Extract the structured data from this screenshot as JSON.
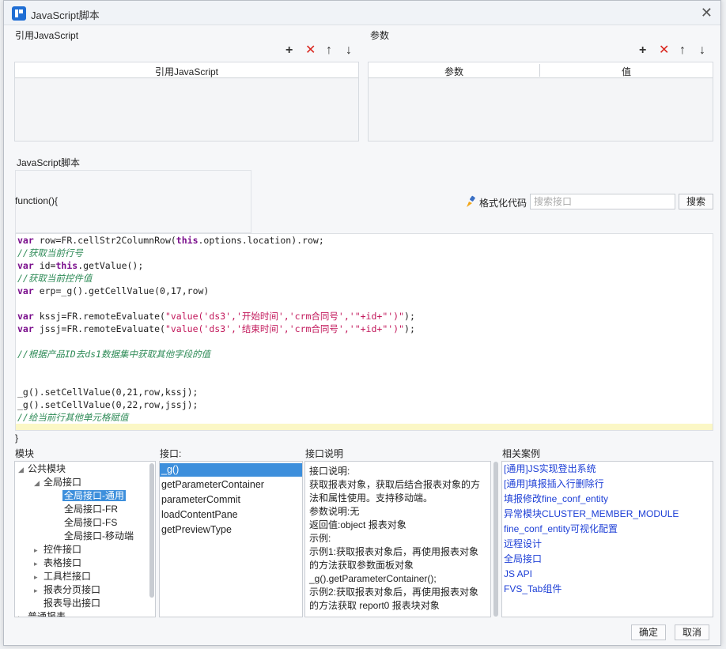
{
  "window": {
    "title": "JavaScript脚本"
  },
  "ref_section": {
    "label": "引用JavaScript",
    "column": "引用JavaScript"
  },
  "param_section": {
    "label": "参数",
    "columns": [
      "参数",
      "值"
    ]
  },
  "script_section": {
    "label": "JavaScript脚本",
    "function_header": "function(){",
    "format_label": "格式化代码",
    "search_placeholder": "搜索接口",
    "search_button": "搜索",
    "closing": "}"
  },
  "code_lines": [
    "var row=FR.cellStr2ColumnRow(this.options.location).row;",
    "//获取当前行号",
    "var id=this.getValue();",
    "//获取当前控件值",
    "var erp=_g().getCellValue(0,17,row)",
    "",
    "var kssj=FR.remoteEvaluate(\"value('ds3','开始时间','crm合同号','\"+id+\"')\");",
    "var jssj=FR.remoteEvaluate(\"value('ds3','结束时间','crm合同号','\"+id+\"')\");",
    "",
    "//根据产品ID去ds1数据集中获取其他字段的值",
    "",
    "",
    "",
    "_g().setCellValue(0,21,row,kssj);",
    "_g().setCellValue(0,22,row,jssj);",
    "//给当前行其他单元格赋值"
  ],
  "module": {
    "label": "模块",
    "tree": [
      "公共模块",
      "全局接口",
      "全局接口-通用",
      "全局接口-FR",
      "全局接口-FS",
      "全局接口-移动端",
      "控件接口",
      "表格接口",
      "工具栏接口",
      "报表分页接口",
      "报表导出接口",
      "普通报表"
    ]
  },
  "interface": {
    "label": "接口:",
    "items": [
      "_g()",
      "getParameterContainer",
      "parameterCommit",
      "loadContentPane",
      "getPreviewType"
    ]
  },
  "description": {
    "label": "接口说明",
    "lines": [
      "接口说明:",
      "获取报表对象，获取后结合报表对象的方",
      "法和属性使用。支持移动端。",
      "参数说明:无",
      "返回值:object 报表对象",
      "示例:",
      "示例1:获取报表对象后，再使用报表对象",
      "的方法获取参数面板对象",
      "_g().getParameterContainer();",
      "示例2:获取报表对象后，再使用报表对象",
      "的方法获取 report0 报表块对象"
    ]
  },
  "cases": {
    "label": "相关案例",
    "links": [
      "[通用]JS实现登出系统",
      "[通用]填报插入行删除行",
      "填报修改fine_conf_entity",
      "异常模块CLUSTER_MEMBER_MODULE",
      "fine_conf_entity可视化配置",
      "远程设计",
      "全局接口",
      "JS API",
      "FVS_Tab组件"
    ]
  },
  "footer": {
    "ok": "确定",
    "cancel": "取消"
  }
}
